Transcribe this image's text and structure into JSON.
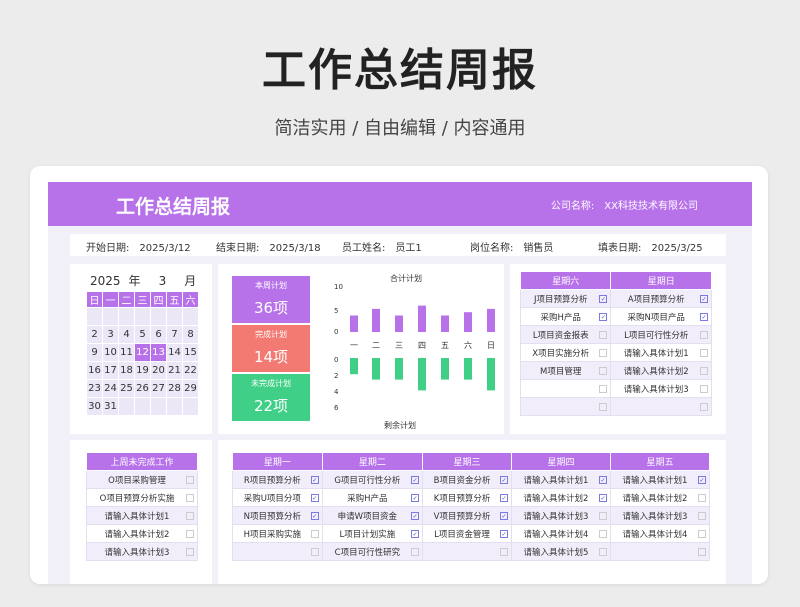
{
  "hero": {
    "title": "工作总结周报",
    "subtitle": "简洁实用 / 自由编辑 / 内容通用"
  },
  "banner": {
    "title": "工作总结周报",
    "company_label": "公司名称:",
    "company_value": "XX科技技术有限公司"
  },
  "info": [
    {
      "label": "开始日期:",
      "value": "2025/3/12"
    },
    {
      "label": "结束日期:",
      "value": "2025/3/18"
    },
    {
      "label": "员工姓名:",
      "value": "员工1"
    },
    {
      "label": "岗位名称:",
      "value": "销售员"
    },
    {
      "label": "填表日期:",
      "value": "2025/3/25"
    }
  ],
  "calendar": {
    "year": "2025",
    "year_unit": "年",
    "month": "3",
    "month_unit": "月",
    "weekdays": [
      "日",
      "一",
      "二",
      "三",
      "四",
      "五",
      "六"
    ],
    "weeks": [
      [
        "",
        "",
        "",
        "",
        "",
        "",
        ""
      ],
      [
        "2",
        "3",
        "4",
        "5",
        "6",
        "7",
        "8"
      ],
      [
        "9",
        "10",
        "11",
        "12",
        "13",
        "14",
        "15"
      ],
      [
        "16",
        "17",
        "18",
        "19",
        "20",
        "21",
        "22"
      ],
      [
        "23",
        "24",
        "25",
        "26",
        "27",
        "28",
        "29"
      ],
      [
        "30",
        "31",
        "",
        "",
        "",
        "",
        ""
      ]
    ],
    "highlight": [
      "12",
      "13"
    ]
  },
  "stats": [
    {
      "label": "本周计划",
      "value": "36项",
      "color": "#b772ea"
    },
    {
      "label": "完成计划",
      "value": "14项",
      "color": "#f27a72"
    },
    {
      "label": "未完成计划",
      "value": "22项",
      "color": "#3fcf87"
    }
  ],
  "chart_data": {
    "type": "bar",
    "title": "合计计划",
    "bottom_title": "剩余计划",
    "categories": [
      "一",
      "二",
      "三",
      "四",
      "五",
      "六",
      "日"
    ],
    "series": [
      {
        "name": "合计计划",
        "values": [
          5,
          7,
          5,
          8,
          5,
          6,
          7
        ],
        "color": "#b772ea"
      },
      {
        "name": "剩余计划",
        "values": [
          3,
          4,
          4,
          6,
          4,
          4,
          6
        ],
        "color": "#3fcf87"
      }
    ],
    "top_ticks": [
      "10",
      "5",
      "0"
    ],
    "bottom_ticks": [
      "0",
      "2",
      "4",
      "6"
    ]
  },
  "weekend": {
    "headers": [
      "星期六",
      "星期日"
    ],
    "rows": [
      [
        {
          "t": "J项目预算分析",
          "c": true
        },
        {
          "t": "A项目预算分析",
          "c": true
        }
      ],
      [
        {
          "t": "采购H产品",
          "c": true
        },
        {
          "t": "采购N项目产品",
          "c": true
        }
      ],
      [
        {
          "t": "L项目资金报表",
          "c": false
        },
        {
          "t": "L项目可行性分析",
          "c": false
        }
      ],
      [
        {
          "t": "X项目实施分析",
          "c": false
        },
        {
          "t": "请输入具体计划1",
          "c": false
        }
      ],
      [
        {
          "t": "M项目管理",
          "c": false
        },
        {
          "t": "请输入具体计划2",
          "c": false
        }
      ],
      [
        {
          "t": "",
          "c": false
        },
        {
          "t": "请输入具体计划3",
          "c": false
        }
      ],
      [
        {
          "t": "",
          "c": false
        },
        {
          "t": "",
          "c": false
        }
      ]
    ]
  },
  "lastweek": {
    "header": "上周未完成工作",
    "rows": [
      "O项目采购管理",
      "O项目预算分析实施",
      "请输入具体计划1",
      "请输入具体计划2",
      "请输入具体计划3"
    ]
  },
  "weekday": {
    "headers": [
      "星期一",
      "星期二",
      "星期三",
      "星期四",
      "星期五"
    ],
    "rows": [
      [
        {
          "t": "R项目预算分析",
          "c": true
        },
        {
          "t": "G项目可行性分析",
          "c": true
        },
        {
          "t": "B项目资金分析",
          "c": true
        },
        {
          "t": "请输入具体计划1",
          "c": true
        },
        {
          "t": "请输入具体计划1",
          "c": true
        }
      ],
      [
        {
          "t": "采购U项目分项",
          "c": true
        },
        {
          "t": "采购H产品",
          "c": true
        },
        {
          "t": "K项目预算分析",
          "c": true
        },
        {
          "t": "请输入具体计划2",
          "c": true
        },
        {
          "t": "请输入具体计划2",
          "c": false
        }
      ],
      [
        {
          "t": "N项目预算分析",
          "c": true
        },
        {
          "t": "申请W项目资金",
          "c": true
        },
        {
          "t": "V项目预算分析",
          "c": true
        },
        {
          "t": "请输入具体计划3",
          "c": false
        },
        {
          "t": "请输入具体计划3",
          "c": false
        }
      ],
      [
        {
          "t": "H项目采购实施",
          "c": false
        },
        {
          "t": "L项目计划实施",
          "c": true
        },
        {
          "t": "L项目资金管理",
          "c": true
        },
        {
          "t": "请输入具体计划4",
          "c": false
        },
        {
          "t": "请输入具体计划4",
          "c": false
        }
      ],
      [
        {
          "t": "",
          "c": false
        },
        {
          "t": "C项目可行性研究",
          "c": false
        },
        {
          "t": "",
          "c": false
        },
        {
          "t": "请输入具体计划5",
          "c": false
        },
        {
          "t": "",
          "c": false
        }
      ]
    ]
  }
}
